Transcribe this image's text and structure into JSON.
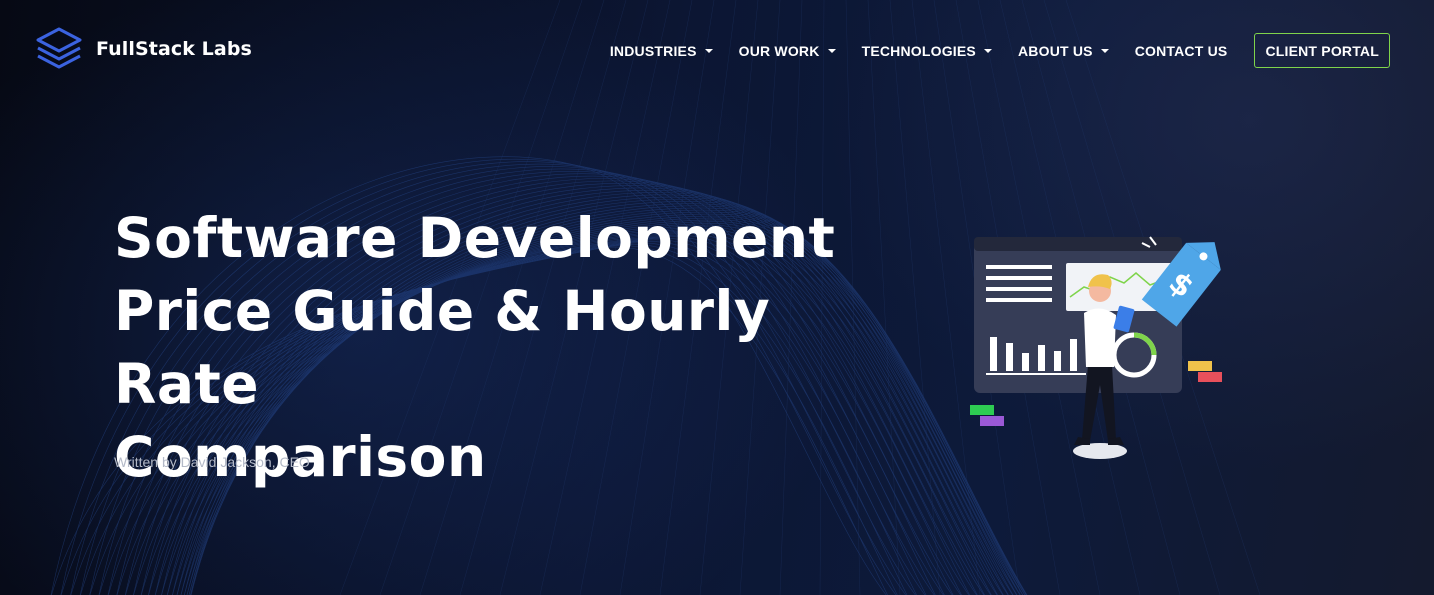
{
  "brand": {
    "name": "FullStack Labs",
    "logo_color": "#3b63e0"
  },
  "nav": {
    "items": [
      {
        "label": "INDUSTRIES",
        "has_dropdown": true
      },
      {
        "label": "OUR WORK",
        "has_dropdown": true
      },
      {
        "label": "TECHNOLOGIES",
        "has_dropdown": true
      },
      {
        "label": "ABOUT US",
        "has_dropdown": true
      },
      {
        "label": "CONTACT US",
        "has_dropdown": false
      }
    ],
    "portal_label": "CLIENT PORTAL",
    "portal_border_color": "#7fd44b"
  },
  "hero": {
    "title_lines": [
      "Software Development",
      "Price Guide & Hourly Rate",
      "Comparison"
    ],
    "byline": "Written by David Jackson, CEO",
    "price_tag_symbol": "$"
  },
  "icons": {
    "logo": "stacked-layers-icon",
    "dropdown": "caret-down-icon",
    "illustration": "analytics-dashboard-person-illustration",
    "price_tag": "price-tag-icon"
  },
  "colors": {
    "background": "#0b1227",
    "text": "#ffffff",
    "muted_text": "#b4bac8",
    "tag_blue": "#4fa6e8",
    "dashboard": "#363d57"
  }
}
